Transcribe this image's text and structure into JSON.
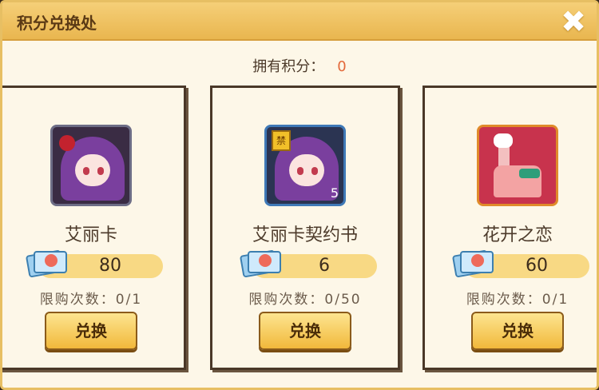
{
  "header": {
    "title": "积分兑换处",
    "close_label": "✖"
  },
  "points": {
    "label": "拥有积分：",
    "value": "0"
  },
  "items": [
    {
      "name": "艾丽卡",
      "cost": "80",
      "limit": "限购次数：0/1",
      "button": "兑换",
      "icon": "erika-portrait-icon"
    },
    {
      "name": "艾丽卡契约书",
      "cost": "6",
      "limit": "限购次数：0/50",
      "button": "兑换",
      "icon": "erika-contract-icon",
      "level": "5",
      "badge": "禁"
    },
    {
      "name": "花开之恋",
      "cost": "60",
      "limit": "限购次数：0/1",
      "button": "兑换",
      "icon": "flower-love-llama-icon"
    }
  ],
  "colors": {
    "accent": "#f1b83b",
    "points_value": "#e3693a",
    "cost_bar": "#f8d984"
  }
}
